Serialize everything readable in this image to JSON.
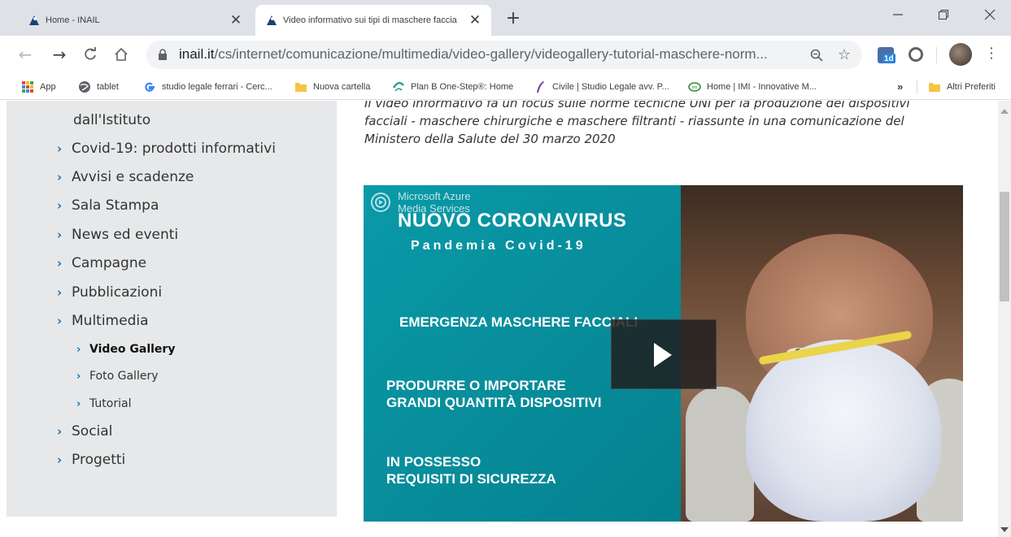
{
  "browser": {
    "tabs": [
      {
        "title": "Home - INAIL",
        "active": false
      },
      {
        "title": "Video informativo sui tipi di maschere faccia",
        "active": true
      }
    ],
    "new_tab_symbol": "+",
    "window_controls": {
      "minimize": "—",
      "maximize": "❐",
      "close": "✕"
    },
    "address": {
      "host": "inail.it",
      "path": "/cs/internet/comunicazione/multimedia/video-gallery/videogallery-tutorial-maschere-norm..."
    },
    "extension_badge": "1d",
    "bookmarks": [
      {
        "label": "App",
        "icon": "apps-grid-icon"
      },
      {
        "label": "tablet",
        "icon": "globe-icon"
      },
      {
        "label": "studio legale ferrari - Cerc...",
        "icon": "google-icon"
      },
      {
        "label": "Nuova cartella",
        "icon": "folder-icon"
      },
      {
        "label": "Plan B One-Step®: Home",
        "icon": "planb-icon"
      },
      {
        "label": "Civile | Studio Legale avv. P...",
        "icon": "quill-icon"
      },
      {
        "label": "Home | IMI - Innovative M...",
        "icon": "imi-icon"
      }
    ],
    "bookmarks_overflow": "»",
    "other_bookmarks": "Altri Preferiti"
  },
  "sidebar": {
    "partial_item": "dall'Istituto",
    "items": [
      {
        "label": "Covid-19: prodotti informativi"
      },
      {
        "label": "Avvisi e scadenze"
      },
      {
        "label": "Sala Stampa"
      },
      {
        "label": "News ed eventi"
      },
      {
        "label": "Campagne"
      },
      {
        "label": "Pubblicazioni"
      },
      {
        "label": "Multimedia"
      }
    ],
    "subitems": [
      {
        "label": "Video Gallery",
        "current": true
      },
      {
        "label": "Foto Gallery",
        "current": false
      },
      {
        "label": "Tutorial",
        "current": false
      }
    ],
    "items_after": [
      {
        "label": "Social"
      },
      {
        "label": "Progetti"
      }
    ],
    "chevron": "›"
  },
  "content": {
    "description": "Il video informativo fa un focus sulle norme tecniche UNI per la produzione dei dispositivi facciali - maschere chirurgiche e maschere filtranti - riassunte in una comunicazione del Ministero della Salute del 30 marzo 2020"
  },
  "video": {
    "brand_line1": "Microsoft Azure",
    "brand_line2": "Media Services",
    "title": "NUOVO CORONAVIRUS",
    "subtitle": "Pandemia Covid-19",
    "line1": "EMERGENZA MASCHERE FACCIALI",
    "line2a": "PRODURRE O IMPORTARE",
    "line2b": "GRANDI QUANTITÀ DISPOSITIVI",
    "line3a": "IN POSSESSO",
    "line3b": "REQUISITI DI SICUREZZA",
    "colors": {
      "panel": "#008a98",
      "mask_strap": "#e9d44a"
    }
  }
}
